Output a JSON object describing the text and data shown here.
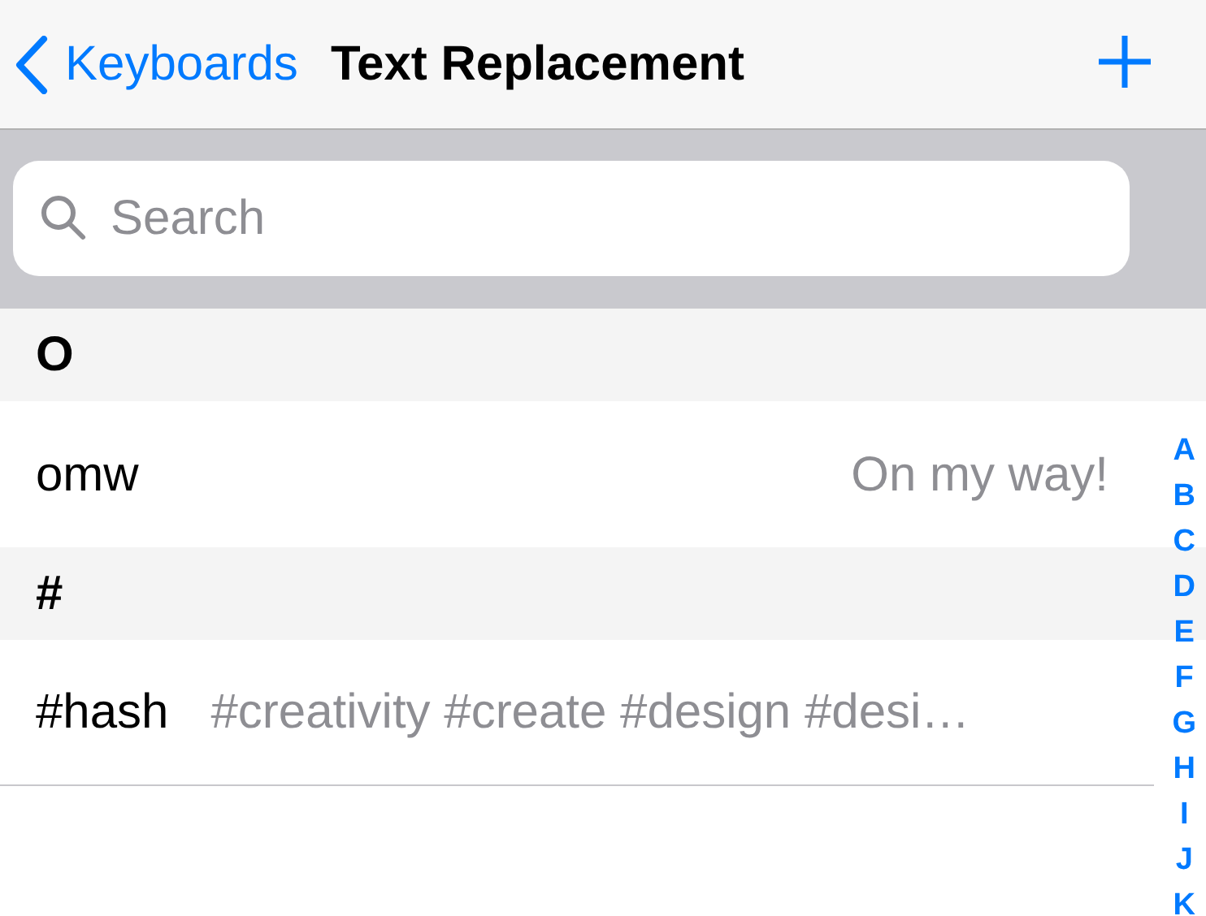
{
  "nav": {
    "back_label": "Keyboards",
    "title": "Text Replacement"
  },
  "search": {
    "placeholder": "Search"
  },
  "sections": [
    {
      "header": "O",
      "rows": [
        {
          "shortcut": "omw",
          "phrase": "On my way!"
        }
      ]
    },
    {
      "header": "#",
      "rows": [
        {
          "shortcut": "#hash",
          "phrase": "#creativity #create #design #desi…"
        }
      ]
    }
  ],
  "index": [
    "A",
    "B",
    "C",
    "D",
    "E",
    "F",
    "G",
    "H",
    "I",
    "J",
    "K"
  ]
}
